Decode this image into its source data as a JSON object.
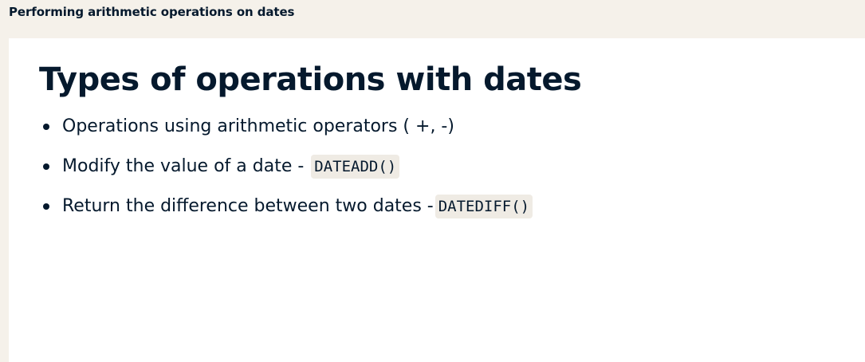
{
  "header": {
    "title": "Performing arithmetic operations on dates"
  },
  "slide": {
    "title": "Types of operations with dates",
    "bullets": [
      {
        "text": "Operations using arithmetic operators ( +, -)",
        "code": ""
      },
      {
        "text": "Modify the value of a date - ",
        "code": "DATEADD()"
      },
      {
        "text": "Return the difference between two dates -",
        "code": "DATEDIFF()"
      }
    ]
  }
}
